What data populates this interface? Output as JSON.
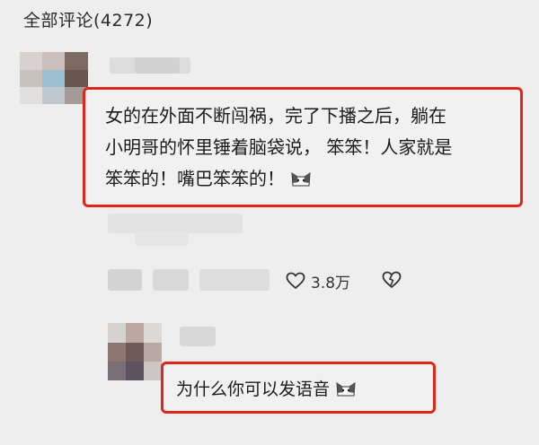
{
  "header": {
    "title": "全部评论(4272)"
  },
  "comment": {
    "lines": [
      "女的在外面不断闯祸，完了下播之后，躺在",
      "小明哥的怀里锤着脑袋说，  笨笨！人家就是",
      "笨笨的！嘴巴笨笨的！"
    ],
    "emoji_icon": "cat-emoji-icon",
    "like_count": "3.8万"
  },
  "reply": {
    "text": "为什么你可以发语音",
    "emoji_icon": "cat-emoji-icon"
  },
  "colors": {
    "highlight_border": "#e0261b",
    "background": "#eeeeee"
  }
}
